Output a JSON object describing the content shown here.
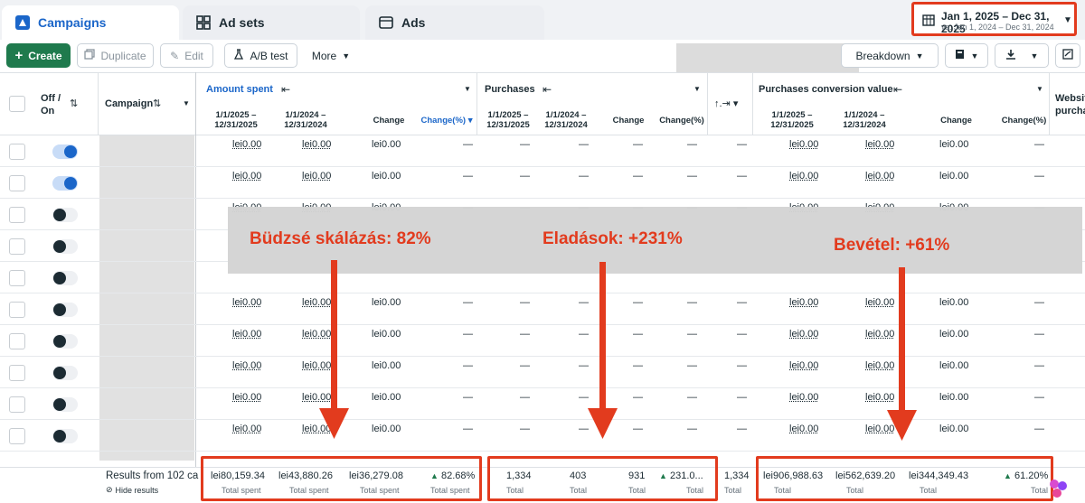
{
  "tabs": [
    {
      "label": "Campaigns"
    },
    {
      "label": "Ad sets"
    },
    {
      "label": "Ads"
    }
  ],
  "date_range": {
    "main": "Jan 1, 2025 – Dec 31, 2025",
    "compare": "vs. Jan 1, 2024 – Dec 31, 2024"
  },
  "toolbar": {
    "create": "Create",
    "duplicate": "Duplicate",
    "edit": "Edit",
    "abtest": "A/B test",
    "more": "More",
    "breakdown": "Breakdown"
  },
  "header": {
    "off_on": "Off / On",
    "campaign": "Campaign",
    "amount_spent": "Amount spent",
    "purchases": "Purchases",
    "pcv": "Purchases conversion value",
    "website": "Website purcha",
    "period_a": "1/1/2025 – 12/31/2025",
    "period_b": "1/1/2024 – 12/31/2024",
    "change": "Change",
    "change_pct": "Change(%)"
  },
  "rows": [
    {
      "toggle": "on",
      "spent_a": "lei0.00",
      "spent_b": "lei0.00",
      "spent_c": "lei0.00",
      "pcv_a": "lei0.00",
      "pcv_b": "lei0.00",
      "pcv_c": "lei0.00"
    },
    {
      "toggle": "on",
      "spent_a": "lei0.00",
      "spent_b": "lei0.00",
      "spent_c": "lei0.00",
      "pcv_a": "lei0.00",
      "pcv_b": "lei0.00",
      "pcv_c": "lei0.00"
    },
    {
      "toggle": "off",
      "spent_a": "lei0.00",
      "spent_b": "lei0.00",
      "spent_c": "lei0.00",
      "pcv_a": "lei0.00",
      "pcv_b": "lei0.00",
      "pcv_c": "lei0.00"
    },
    {
      "toggle": "off"
    },
    {
      "toggle": "off"
    },
    {
      "toggle": "off",
      "spent_a": "lei0.00",
      "spent_b": "lei0.00",
      "spent_c": "lei0.00",
      "pcv_a": "lei0.00",
      "pcv_b": "lei0.00",
      "pcv_c": "lei0.00"
    },
    {
      "toggle": "off",
      "spent_a": "lei0.00",
      "spent_b": "lei0.00",
      "spent_c": "lei0.00",
      "pcv_a": "lei0.00",
      "pcv_b": "lei0.00",
      "pcv_c": "lei0.00"
    },
    {
      "toggle": "off",
      "spent_a": "lei0.00",
      "spent_b": "lei0.00",
      "spent_c": "lei0.00",
      "pcv_a": "lei0.00",
      "pcv_b": "lei0.00",
      "pcv_c": "lei0.00"
    },
    {
      "toggle": "off",
      "spent_a": "lei0.00",
      "spent_b": "lei0.00",
      "spent_c": "lei0.00",
      "pcv_a": "lei0.00",
      "pcv_b": "lei0.00",
      "pcv_c": "lei0.00"
    },
    {
      "toggle": "off",
      "spent_a": "lei0.00",
      "spent_b": "lei0.00",
      "spent_c": "lei0.00",
      "pcv_a": "lei0.00",
      "pcv_b": "lei0.00",
      "pcv_c": "lei0.00"
    }
  ],
  "dash": "—",
  "callouts": {
    "budget": "Büdzsé skálázás: 82%",
    "sales": "Eladások: +231%",
    "revenue": "Bevétel: +61%"
  },
  "footer": {
    "results": "Results from 102 ca",
    "hide": "Hide results",
    "spent_a": "lei80,159.34",
    "spent_b": "lei43,880.26",
    "spent_c": "lei36,279.08",
    "spent_pct": "82.68%",
    "spent_label": "Total spent",
    "pur_a": "1,334",
    "pur_b": "403",
    "pur_c": "931",
    "pur_pct": "231.0...",
    "total_label": "Total",
    "extra": "1,334",
    "pcv_a": "lei906,988.63",
    "pcv_b": "lei562,639.20",
    "pcv_c": "lei344,349.43",
    "pcv_pct": "61.20%"
  },
  "colors": {
    "accent": "#1b66c9",
    "highlight": "#e23b1e",
    "create": "#1f7a4d"
  }
}
